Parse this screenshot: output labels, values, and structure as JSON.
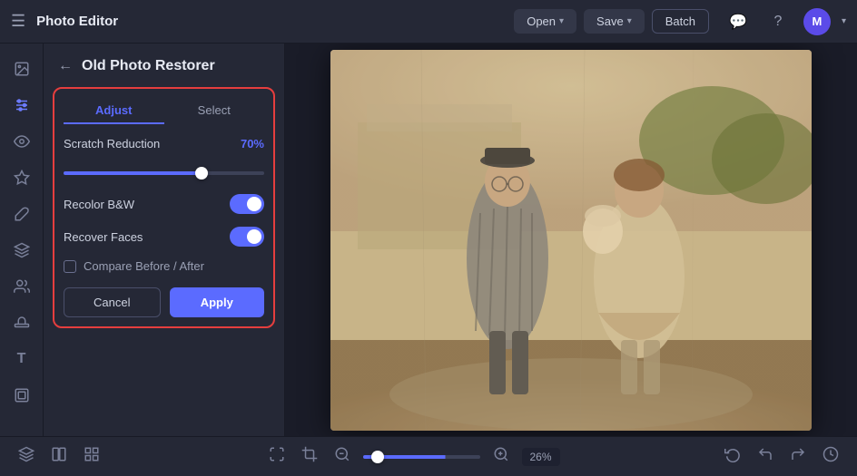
{
  "app": {
    "title": "Photo Editor",
    "menu_icon": "☰"
  },
  "topbar": {
    "open_label": "Open",
    "save_label": "Save",
    "batch_label": "Batch",
    "avatar_letter": "M"
  },
  "sidebar_icons": [
    {
      "name": "image-icon",
      "glyph": "🖼",
      "active": false
    },
    {
      "name": "adjust-icon",
      "glyph": "⚙",
      "active": true
    },
    {
      "name": "eye-icon",
      "glyph": "👁",
      "active": false
    },
    {
      "name": "magic-icon",
      "glyph": "✨",
      "active": false
    },
    {
      "name": "brush-icon",
      "glyph": "🖌",
      "active": false
    },
    {
      "name": "layers-icon",
      "glyph": "▤",
      "active": false
    },
    {
      "name": "people-icon",
      "glyph": "👤",
      "active": false
    },
    {
      "name": "stamp-icon",
      "glyph": "◈",
      "active": false
    },
    {
      "name": "text-icon",
      "glyph": "T",
      "active": false
    },
    {
      "name": "frame-icon",
      "glyph": "⬜",
      "active": false
    }
  ],
  "panel": {
    "back_button": "←",
    "title": "Old Photo Restorer",
    "tabs": [
      {
        "id": "adjust",
        "label": "Adjust",
        "active": true
      },
      {
        "id": "select",
        "label": "Select",
        "active": false
      }
    ],
    "scratch_reduction": {
      "label": "Scratch Reduction",
      "value": "70%",
      "slider_value": 70
    },
    "recolor_bw": {
      "label": "Recolor B&W",
      "enabled": true
    },
    "recover_faces": {
      "label": "Recover Faces",
      "enabled": true
    },
    "compare": {
      "label": "Compare Before / After",
      "checked": false
    },
    "cancel_label": "Cancel",
    "apply_label": "Apply"
  },
  "bottombar": {
    "zoom_value": "26%",
    "zoom_numeric": 26
  }
}
